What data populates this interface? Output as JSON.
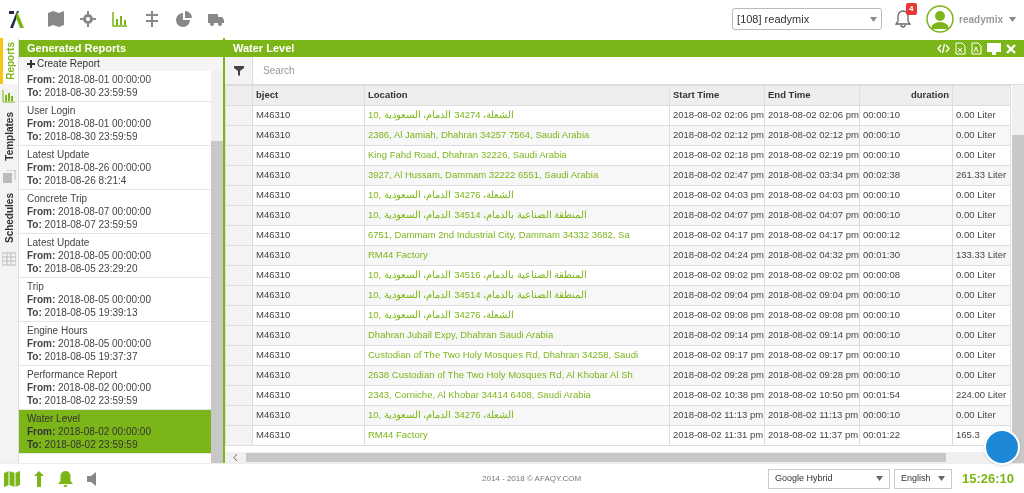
{
  "top_nav": {
    "items": [
      {
        "kind": "map",
        "selected": false
      },
      {
        "kind": "gear",
        "selected": false
      },
      {
        "kind": "chart",
        "selected": true
      },
      {
        "kind": "sign",
        "selected": false
      },
      {
        "kind": "pie",
        "selected": false
      },
      {
        "kind": "truck",
        "selected": false
      }
    ],
    "account_select": "[108] readymix",
    "notification_count": "4",
    "user_name": "readymix"
  },
  "side_tabs": [
    {
      "label": "Reports",
      "selected": true
    },
    {
      "label": "Templates",
      "selected": false
    },
    {
      "label": "Schedules",
      "selected": false
    }
  ],
  "sidebar": {
    "title": "Generated Reports",
    "create_label": "Create Report",
    "items": [
      {
        "from": "**From:** 2018-08-01 00:00:00",
        "to": "**To:** 2018-08-30 23:59:59",
        "selected": false
      },
      {
        "name": "User Login",
        "from": "**From:** 2018-08-01 00:00:00",
        "to": "**To:** 2018-08-30 23:59:59",
        "selected": false
      },
      {
        "name": "Latest Update",
        "from": "**From:** 2018-08-26 00:00:00",
        "to": "**To:** 2018-08-26 8:21:4",
        "selected": false
      },
      {
        "name": "Concrete Trip",
        "from": "**From:** 2018-08-07 00:00:00",
        "to": "**To:** 2018-08-07 23:59:59",
        "selected": false
      },
      {
        "name": "Latest Update",
        "from": "**From:** 2018-08-05 00:00:00",
        "to": "**To:** 2018-08-05 23:29:20",
        "selected": false
      },
      {
        "name": "Trip",
        "from": "**From:** 2018-08-05 00:00:00",
        "to": "**To:** 2018-08-05 19:39:13",
        "selected": false
      },
      {
        "name": "Engine Hours",
        "from": "**From:** 2018-08-05 00:00:00",
        "to": "**To:** 2018-08-05 19:37:37",
        "selected": false
      },
      {
        "name": "Performance Report",
        "from": "**From:** 2018-08-02 00:00:00",
        "to": "**To:** 2018-08-02 23:59:59",
        "selected": false
      },
      {
        "name": "Water Level",
        "from": "**From:** 2018-08-02 00:00:00",
        "to": "**To:** 2018-08-02 23:59:59",
        "selected": true
      }
    ]
  },
  "report": {
    "title": "Water Level",
    "search_placeholder": "Search",
    "table": {
      "columns": [
        "bject",
        "Location",
        "Start Time",
        "End Time",
        "duration"
      ],
      "rows": [
        [
          "M46310",
          "10, الشعلة، 34274 الدمام، السعودية",
          "2018-08-02 02:06 pm",
          "2018-08-02 02:06 pm",
          "00:00:10",
          "0.00 Liter"
        ],
        [
          "M46310",
          "2386, Al Jamiah, Dhahran 34257 7564, Saudi Arabia",
          "2018-08-02 02:12 pm",
          "2018-08-02 02:12 pm",
          "00:00:10",
          "0.00 Liter"
        ],
        [
          "M46310",
          "King Fahd Road, Dhahran 32226, Saudi Arabia",
          "2018-08-02 02:18 pm",
          "2018-08-02 02:19 pm",
          "00:00:10",
          "0.00 Liter"
        ],
        [
          "M46310",
          "3927, Al Hussam, Dammam 32222 6551, Saudi Arabia",
          "2018-08-02 02:47 pm",
          "2018-08-02 03:34 pm",
          "00:02:38",
          "261.33 Liter"
        ],
        [
          "M46310",
          "10, الشعلة، 34276 الدمام، السعودية",
          "2018-08-02 04:03 pm",
          "2018-08-02 04:03 pm",
          "00:00:10",
          "0.00 Liter"
        ],
        [
          "M46310",
          "10, المنطقة الصناعية بالدمام، 34514 الدمام، السعودية",
          "2018-08-02 04:07 pm",
          "2018-08-02 04:07 pm",
          "00:00:10",
          "0.00 Liter"
        ],
        [
          "M46310",
          "6751, Dammam 2nd Industrial City, Dammam 34332 3682, Sa",
          "2018-08-02 04:17 pm",
          "2018-08-02 04:17 pm",
          "00:00:12",
          "0.00 Liter"
        ],
        [
          "M46310",
          "RM44 Factory",
          "2018-08-02 04:24 pm",
          "2018-08-02 04:32 pm",
          "00:01:30",
          "133.33 Liter"
        ],
        [
          "M46310",
          "10, المنطقة الصناعية بالدمام، 34516 الدمام، السعودية",
          "2018-08-02 09:02 pm",
          "2018-08-02 09:02 pm",
          "00:00:08",
          "0.00 Liter"
        ],
        [
          "M46310",
          "10, المنطقة الصناعية بالدمام، 34514 الدمام، السعودية",
          "2018-08-02 09:04 pm",
          "2018-08-02 09:04 pm",
          "00:00:10",
          "0.00 Liter"
        ],
        [
          "M46310",
          "10, الشعلة، 34276 الدمام، السعودية",
          "2018-08-02 09:08 pm",
          "2018-08-02 09:08 pm",
          "00:00:10",
          "0.00 Liter"
        ],
        [
          "M46310",
          "Dhahran Jubail Expy, Dhahran Saudi Arabia",
          "2018-08-02 09:14 pm",
          "2018-08-02 09:14 pm",
          "00:00:10",
          "0.00 Liter"
        ],
        [
          "M46310",
          "Custodian of The Two Holy Mosques Rd, Dhahran 34258, Saudi",
          "2018-08-02 09:17 pm",
          "2018-08-02 09:17 pm",
          "00:00:10",
          "0.00 Liter"
        ],
        [
          "M46310",
          "2638 Custodian of The Two Holy Mosques Rd, Al Khobar Al Sh",
          "2018-08-02 09:28 pm",
          "2018-08-02 09:28 pm",
          "00:00:10",
          "0.00 Liter"
        ],
        [
          "M46310",
          "2343, Corniche, Al Khobar 34414 6408, Saudi Arabia",
          "2018-08-02 10:38 pm",
          "2018-08-02 10:50 pm",
          "00:01:54",
          "224.00 Liter"
        ],
        [
          "M46310",
          "10, الشعلة، 34276 الدمام، السعودية",
          "2018-08-02 11:13 pm",
          "2018-08-02 11:13 pm",
          "00:00:10",
          "0.00 Liter"
        ],
        [
          "M46310",
          "RM44 Factory",
          "2018-08-02 11:31 pm",
          "2018-08-02 11:37 pm",
          "00:01:22",
          "165.3"
        ]
      ]
    }
  },
  "footer": {
    "copyright": "2014 - 2018 © AFAQY.COM",
    "map_layer": "Google Hybrid",
    "language": "English",
    "time": "15:26:10"
  }
}
